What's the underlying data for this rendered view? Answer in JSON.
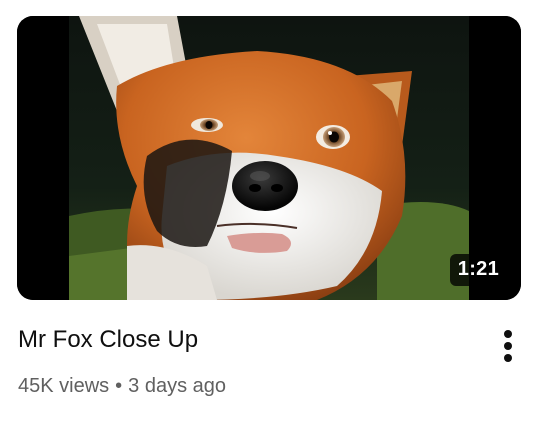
{
  "video": {
    "title": "Mr Fox Close Up",
    "duration": "1:21",
    "views": "45K views",
    "separator": "•",
    "age": "3 days ago",
    "thumbnail_subject": "fox-face-closeup"
  },
  "menu": {
    "icon": "more-vert-icon"
  },
  "colors": {
    "title": "#0f0f0f",
    "meta": "#606060",
    "duration_bg": "#000000",
    "duration_text": "#ffffff"
  }
}
